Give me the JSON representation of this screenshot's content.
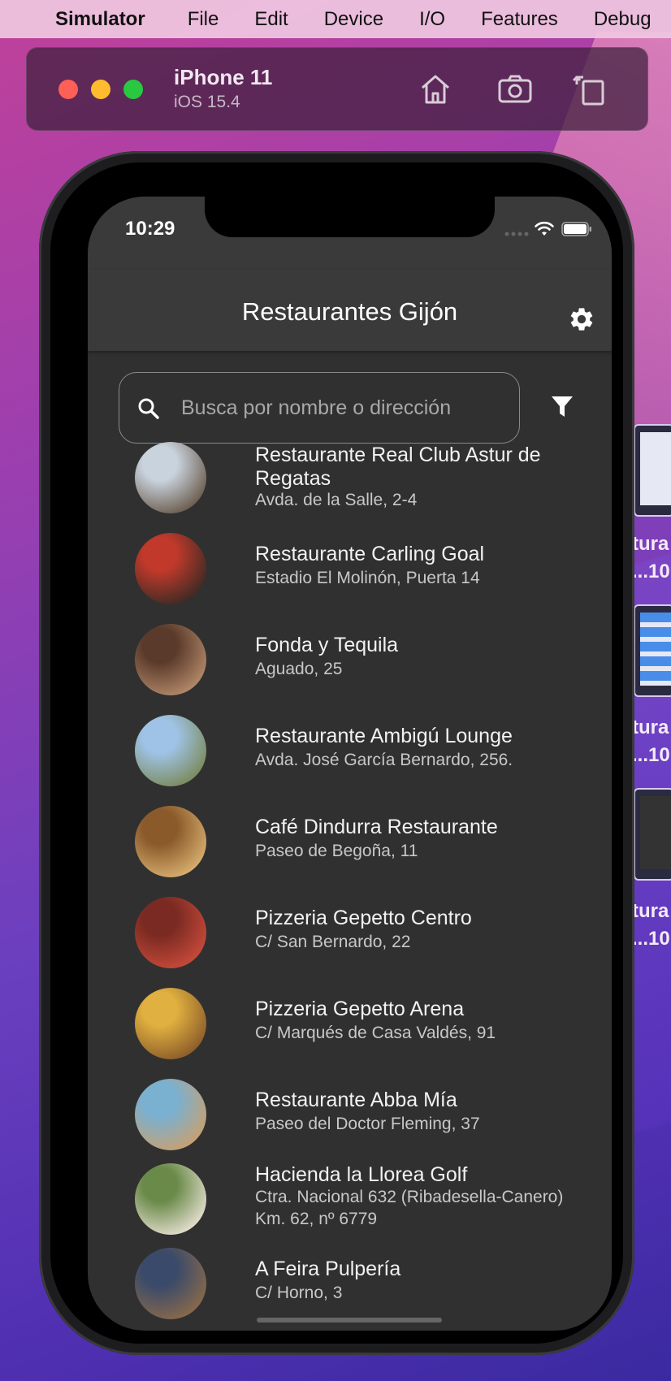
{
  "menubar": {
    "app_name": "Simulator",
    "items": [
      "File",
      "Edit",
      "Device",
      "I/O",
      "Features",
      "Debug"
    ]
  },
  "simulator": {
    "device_name": "iPhone 11",
    "os_version": "iOS 15.4",
    "tools": [
      "home-icon",
      "screenshot-icon",
      "rotate-icon"
    ]
  },
  "background_windows": {
    "label_fragments": [
      "tura",
      "...10"
    ]
  },
  "status_bar": {
    "time": "10:29"
  },
  "app": {
    "title": "Restaurantes Gijón",
    "search_placeholder": "Busca por nombre o dirección",
    "restaurants": [
      {
        "name": "Restaurante Real Club Astur de Regatas",
        "address": "Avda. de la Salle, 2-4",
        "photo_colors": [
          "#c9d3de",
          "#6a5a4a"
        ]
      },
      {
        "name": "Restaurante Carling Goal",
        "address": "Estadio El Molinón, Puerta 14",
        "photo_colors": [
          "#c0392b",
          "#3a2a24"
        ]
      },
      {
        "name": "Fonda y Tequila",
        "address": "Aguado, 25",
        "photo_colors": [
          "#5a3a2a",
          "#b48a6a"
        ]
      },
      {
        "name": "Restaurante Ambigú Lounge",
        "address": "Avda. José García Bernardo, 256.",
        "photo_colors": [
          "#9fc3e6",
          "#7a8a5a"
        ]
      },
      {
        "name": "Café Dindurra Restaurante",
        "address": "Paseo de Begoña, 11",
        "photo_colors": [
          "#8a5a2a",
          "#d9b070"
        ]
      },
      {
        "name": "Pizzeria Gepetto Centro",
        "address": "C/ San Bernardo, 22",
        "photo_colors": [
          "#7a2a22",
          "#c84a3a"
        ]
      },
      {
        "name": "Pizzeria Gepetto Arena",
        "address": "C/ Marqués de Casa Valdés, 91",
        "photo_colors": [
          "#e0b040",
          "#8a5a2a"
        ]
      },
      {
        "name": "Restaurante Abba Mía",
        "address": "Paseo del Doctor Fleming, 37",
        "photo_colors": [
          "#7ab0d0",
          "#c8a070"
        ]
      },
      {
        "name": "Hacienda la Llorea Golf",
        "address": "Ctra. Nacional 632 (Ribadesella-Canero) Km. 62, nº 6779",
        "photo_colors": [
          "#6a8a4a",
          "#e6e0d0"
        ]
      },
      {
        "name": "A Feira Pulpería",
        "address": "C/ Horno, 3",
        "photo_colors": [
          "#3a4a6a",
          "#8a6a4a"
        ]
      }
    ]
  },
  "colors": {
    "screen_bg": "#303030",
    "appbar_bg": "#3a3a3a",
    "text_primary": "#f2f2f2",
    "text_secondary": "#c8c8c8"
  }
}
